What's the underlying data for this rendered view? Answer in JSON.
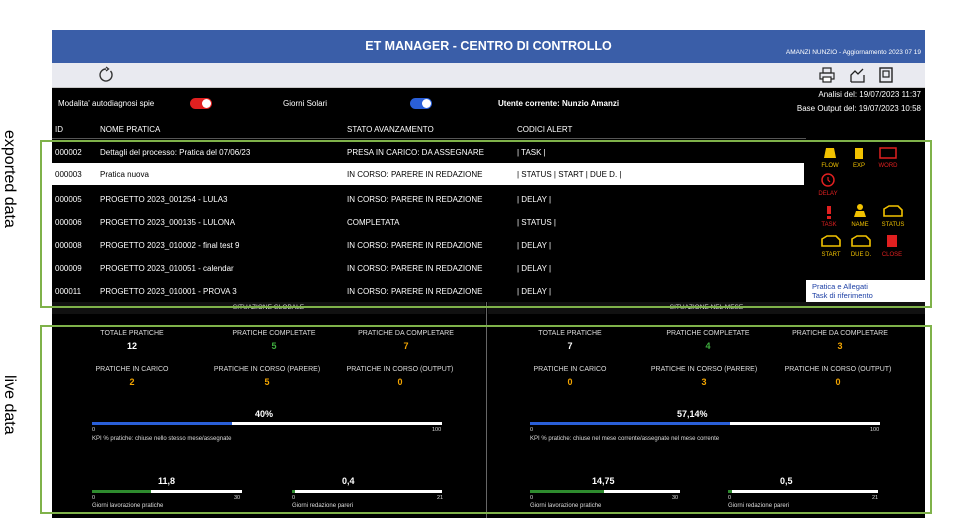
{
  "app": {
    "title": "ET MANAGER - CENTRO DI CONTROLLO",
    "user_update": "AMANZI NUNZIO - Aggiornamento 2023 07 19"
  },
  "toolbar": {
    "refresh_icon": "refresh-icon",
    "right_icons": [
      "print-icon",
      "chart-icon",
      "window-icon"
    ]
  },
  "status": {
    "autodiag_label": "Modalita' autodiagnosi spie",
    "solar_label": "Giorni Solari",
    "current_user": "Utente corrente: Nunzio Amanzi",
    "analysis": "Analisi del: 19/07/2023 11:37",
    "base_output": "Base Output del: 19/07/2023 10:58"
  },
  "table": {
    "headers": [
      "ID",
      "NOME PRATICA",
      "STATO AVANZAMENTO",
      "CODICI ALERT"
    ],
    "rows": [
      {
        "id": "000002",
        "name": "Dettagli del processo: Pratica del 07/06/23",
        "state": "PRESA IN CARICO: DA ASSEGNARE",
        "alert": "| TASK |"
      },
      {
        "id": "000003",
        "name": "Pratica nuova",
        "state": "IN CORSO: PARERE IN REDAZIONE",
        "alert": "| STATUS | START | DUE D. |"
      },
      {
        "id": "000005",
        "name": "PROGETTO 2023_001254 - LULA3",
        "state": "IN CORSO: PARERE IN REDAZIONE",
        "alert": "| DELAY |"
      },
      {
        "id": "000006",
        "name": "PROGETTO 2023_000135 - LULONA",
        "state": "COMPLETATA",
        "alert": "| STATUS |"
      },
      {
        "id": "000008",
        "name": "PROGETTO 2023_010002 - final test 9",
        "state": "IN CORSO: PARERE IN REDAZIONE",
        "alert": "| DELAY |"
      },
      {
        "id": "000009",
        "name": "PROGETTO 2023_010051 - calendar",
        "state": "IN CORSO: PARERE IN REDAZIONE",
        "alert": "| DELAY |"
      },
      {
        "id": "000011",
        "name": "PROGETTO 2023_010001 - PROVA 3",
        "state": "IN CORSO: PARERE IN REDAZIONE",
        "alert": "| DELAY |"
      }
    ]
  },
  "legend": {
    "items": [
      {
        "label": "FLOW",
        "color": "#f2c200",
        "icon": "traffic-light-icon"
      },
      {
        "label": "EXP",
        "color": "#f2c200",
        "icon": "fuel-icon"
      },
      {
        "label": "WORD",
        "color": "#e02020",
        "icon": "text-icon"
      },
      {
        "label": "DELAY",
        "color": "#e02020",
        "icon": "clock-icon"
      },
      {
        "label": "TASK",
        "color": "#e02020",
        "icon": "alert-icon"
      },
      {
        "label": "NAME",
        "color": "#f2c200",
        "icon": "person-icon"
      },
      {
        "label": "STATUS",
        "color": "#f2c200",
        "icon": "engine-icon"
      },
      {
        "label": "START",
        "color": "#f2c200",
        "icon": "engine-icon"
      },
      {
        "label": "DUE D.",
        "color": "#f2c200",
        "icon": "engine-icon"
      },
      {
        "label": "CLOSE",
        "color": "#e02020",
        "icon": "door-icon"
      }
    ]
  },
  "links": [
    "Pratica e Allegati",
    "Task di riferimento"
  ],
  "global": {
    "title": "SITUAZIONE GLOBALE",
    "kpis": [
      {
        "label": "TOTALE PRATICHE",
        "value": "12",
        "color": "#ffffff"
      },
      {
        "label": "PRATICHE COMPLETATE",
        "value": "5",
        "color": "#3fae3f"
      },
      {
        "label": "PRATICHE DA COMPLETARE",
        "value": "7",
        "color": "#f2a400"
      },
      {
        "label": "PRATICHE IN CARICO",
        "value": "2",
        "color": "#f2a400"
      },
      {
        "label": "PRATICHE IN CORSO (PARERE)",
        "value": "5",
        "color": "#f2a400"
      },
      {
        "label": "PRATICHE IN CORSO (OUTPUT)",
        "value": "0",
        "color": "#f2a400"
      }
    ],
    "kpi_pct": "40%",
    "kpi_fill": 0.4,
    "kpi_min": "0",
    "kpi_max": "100",
    "kpi_note": "KPI % pratiche: chiuse nello stesso mese/assegnate",
    "days_work": "11,8",
    "days_work_fill": 0.393,
    "days_work_max": "30",
    "days_work_label": "Giorni lavorazione pratiche",
    "days_opinion": "0,4",
    "days_opinion_fill": 0.019,
    "days_opinion_max": "21",
    "days_opinion_label": "Giorni redazione pareri",
    "zero": "0"
  },
  "month": {
    "title": "SITUAZIONE NEL MESE",
    "kpis": [
      {
        "label": "TOTALE PRATICHE",
        "value": "7",
        "color": "#ffffff"
      },
      {
        "label": "PRATICHE COMPLETATE",
        "value": "4",
        "color": "#3fae3f"
      },
      {
        "label": "PRATICHE DA COMPLETARE",
        "value": "3",
        "color": "#f2a400"
      },
      {
        "label": "PRATICHE IN CARICO",
        "value": "0",
        "color": "#f2a400"
      },
      {
        "label": "PRATICHE IN CORSO (PARERE)",
        "value": "3",
        "color": "#f2a400"
      },
      {
        "label": "PRATICHE IN CORSO (OUTPUT)",
        "value": "0",
        "color": "#f2a400"
      }
    ],
    "kpi_pct": "57,14%",
    "kpi_fill": 0.5714,
    "kpi_min": "0",
    "kpi_max": "100",
    "kpi_note": "KPI % pratiche: chiuse nel mese corrente/assegnate nel mese corrente",
    "days_work": "14,75",
    "days_work_fill": 0.492,
    "days_work_max": "30",
    "days_work_label": "Giorni lavorazione pratiche",
    "days_opinion": "0,5",
    "days_opinion_fill": 0.024,
    "days_opinion_max": "21",
    "days_opinion_label": "Giorni redazione pareri",
    "zero": "0"
  },
  "annotations": {
    "top": "exported data",
    "bottom": "live data"
  },
  "colors": {
    "titlebar": "#3a5ea8",
    "toggle_on": "#e02020",
    "toggle_blue": "#2a5fd8",
    "kpi_bar": "#2a5fd8",
    "days_bar": "#2e8b2e",
    "frame": "#7fb24a"
  }
}
